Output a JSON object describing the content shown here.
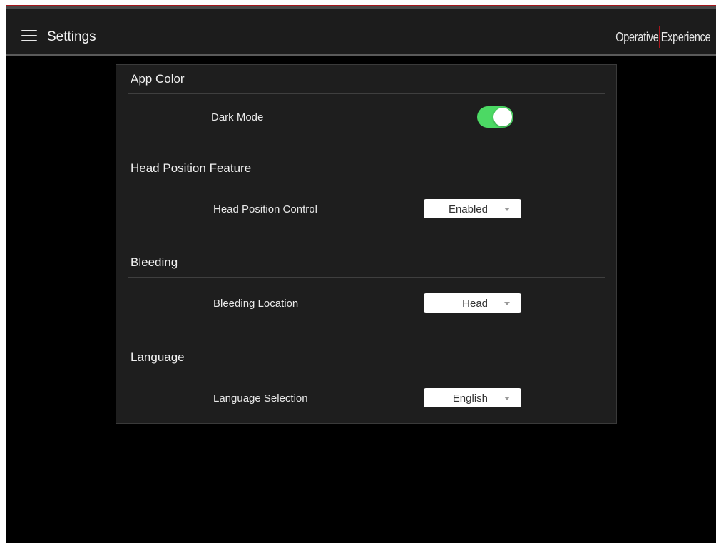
{
  "header": {
    "title": "Settings",
    "menu_icon": "hamburger-menu-icon",
    "logo_left": "Operative",
    "logo_right": "Experience",
    "accent_color": "#a6151b"
  },
  "sections": [
    {
      "title": "App Color",
      "row_label": "Dark Mode",
      "control": "toggle",
      "toggle_on": true,
      "toggle_color": "#4cd964"
    },
    {
      "title": "Head Position Feature",
      "row_label": "Head Position Control",
      "control": "select",
      "value": "Enabled"
    },
    {
      "title": "Bleeding",
      "row_label": "Bleeding Location",
      "control": "select",
      "value": "Head"
    },
    {
      "title": "Language",
      "row_label": "Language Selection",
      "control": "select",
      "value": "English"
    }
  ]
}
